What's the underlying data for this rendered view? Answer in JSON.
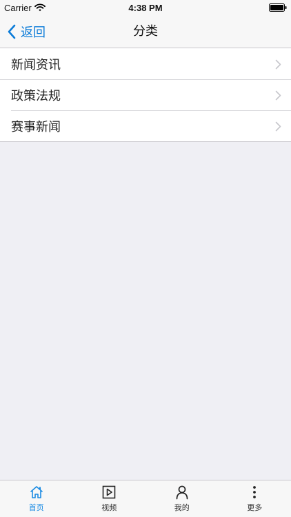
{
  "status_bar": {
    "carrier": "Carrier",
    "time": "4:38 PM",
    "wifi_icon": "wifi-icon",
    "battery_icon": "battery-icon"
  },
  "nav": {
    "back_label": "返回",
    "title": "分类",
    "back_icon": "chevron-left-icon"
  },
  "list": {
    "items": [
      {
        "label": "新闻资讯",
        "icon": "chevron-right-icon"
      },
      {
        "label": "政策法规",
        "icon": "chevron-right-icon"
      },
      {
        "label": "赛事新闻",
        "icon": "chevron-right-icon"
      }
    ]
  },
  "tabs": [
    {
      "label": "首页",
      "icon": "home-icon",
      "active": true
    },
    {
      "label": "视频",
      "icon": "play-icon",
      "active": false
    },
    {
      "label": "我的",
      "icon": "user-icon",
      "active": false
    },
    {
      "label": "更多",
      "icon": "more-icon",
      "active": false
    }
  ],
  "colors": {
    "accent": "#0a7bd8",
    "tab_active": "#1a8be3",
    "background": "#efeff4",
    "bar_background": "#f7f7f7"
  }
}
